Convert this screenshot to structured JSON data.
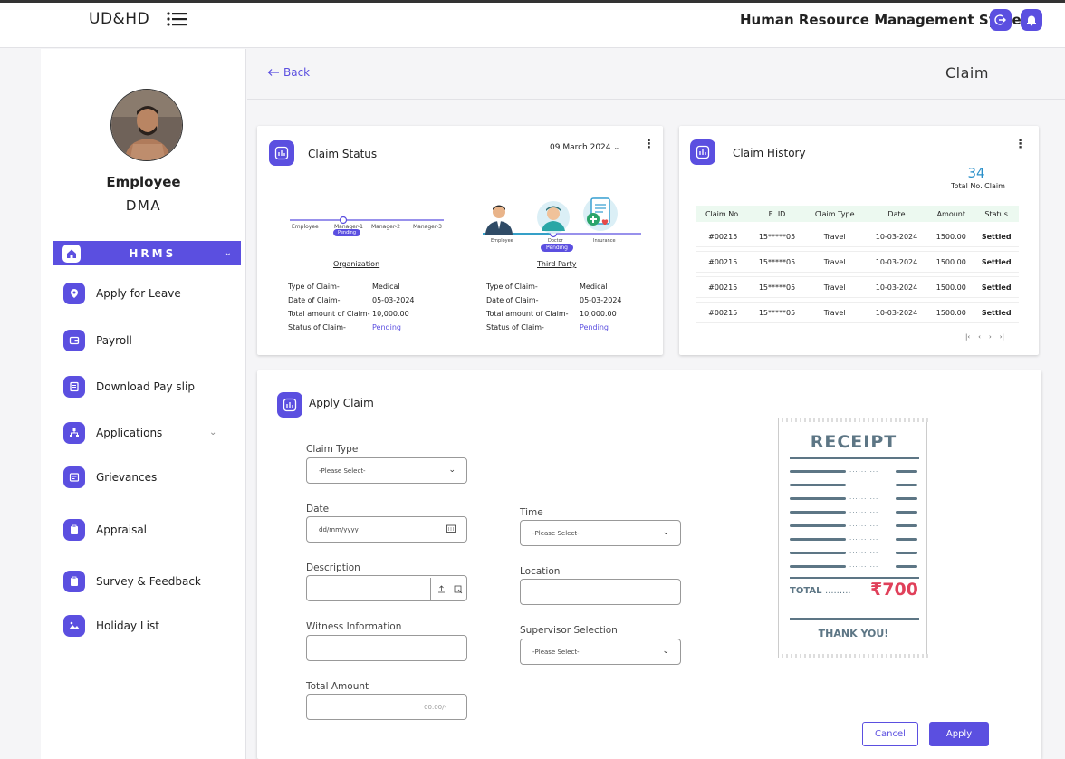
{
  "topbar": {
    "logo": "UD&HD",
    "app_title": "Human Resource Management System"
  },
  "sidebar": {
    "employee_name": "Employee",
    "employee_dept": "DMA",
    "hrms_label": "HRMS",
    "items": [
      {
        "label": "Apply for Leave",
        "icon": "location-pin-icon"
      },
      {
        "label": "Payroll",
        "icon": "wallet-icon"
      },
      {
        "label": "Download Pay slip",
        "icon": "document-icon"
      },
      {
        "label": "Applications",
        "icon": "sitemap-icon"
      },
      {
        "label": "Grievances",
        "icon": "grievance-icon"
      },
      {
        "label": "Appraisal",
        "icon": "clipboard-icon"
      },
      {
        "label": "Survey & Feedback",
        "icon": "survey-icon"
      },
      {
        "label": "Holiday List",
        "icon": "holiday-icon"
      }
    ]
  },
  "header": {
    "back_label": "Back",
    "page_title": "Claim"
  },
  "claim_status": {
    "title": "Claim Status",
    "date": "09 March 2024",
    "org": {
      "steps": [
        "Employee",
        "Manager-1",
        "Manager-2",
        "Manager-3"
      ],
      "pending_badge": "Pending",
      "caption": "Organization",
      "fields": [
        {
          "label": "Type of Claim-",
          "value": "Medical"
        },
        {
          "label": "Date of Claim-",
          "value": "05-03-2024"
        },
        {
          "label": "Total amount of Claim-",
          "value": "10,000.00"
        },
        {
          "label": "Status of Claim-",
          "value": "Pending"
        }
      ]
    },
    "third": {
      "steps": [
        "Employee",
        "Doctor",
        "Insurance"
      ],
      "pending_badge": "Pending",
      "caption": "Third Party",
      "fields": [
        {
          "label": "Type of Claim-",
          "value": "Medical"
        },
        {
          "label": "Date of Claim-",
          "value": "05-03-2024"
        },
        {
          "label": "Total amount of Claim-",
          "value": "10,000.00"
        },
        {
          "label": "Status of Claim-",
          "value": "Pending"
        }
      ]
    }
  },
  "claim_history": {
    "title": "Claim History",
    "total_count": "34",
    "total_label": "Total No. Claim",
    "columns": [
      "Claim No.",
      "E. ID",
      "Claim Type",
      "Date",
      "Amount",
      "Status"
    ],
    "rows": [
      [
        "#00215",
        "15*****05",
        "Travel",
        "10-03-2024",
        "1500.00",
        "Settled"
      ],
      [
        "#00215",
        "15*****05",
        "Travel",
        "10-03-2024",
        "1500.00",
        "Settled"
      ],
      [
        "#00215",
        "15*****05",
        "Travel",
        "10-03-2024",
        "1500.00",
        "Settled"
      ],
      [
        "#00215",
        "15*****05",
        "Travel",
        "10-03-2024",
        "1500.00",
        "Settled"
      ]
    ],
    "pager": [
      "|‹",
      "‹",
      "›",
      "›|"
    ]
  },
  "apply_claim": {
    "title": "Apply Claim",
    "claim_type_label": "Claim Type",
    "claim_type_value": "-Please Select-",
    "date_label": "Date",
    "date_placeholder": "dd/mm/yyyy",
    "time_label": "Time",
    "time_value": "-Please Select-",
    "description_label": "Description",
    "location_label": "Location",
    "witness_label": "Witness Information",
    "supervisor_label": "Supervisor Selection",
    "supervisor_value": "-Please Select-",
    "total_amount_label": "Total Amount",
    "total_amount_placeholder": "00.00/-",
    "cancel_label": "Cancel",
    "apply_label": "Apply"
  },
  "receipt": {
    "title": "RECEIPT",
    "total_label": "TOTAL",
    "total_dots": ".........",
    "amount": "₹700",
    "thanks": "THANK YOU!",
    "dots": ".........."
  },
  "colors": {
    "accent": "#5b4fe0",
    "settled": "#2e9d3e",
    "receipt": "#5d7685",
    "amount": "#e0405a"
  }
}
